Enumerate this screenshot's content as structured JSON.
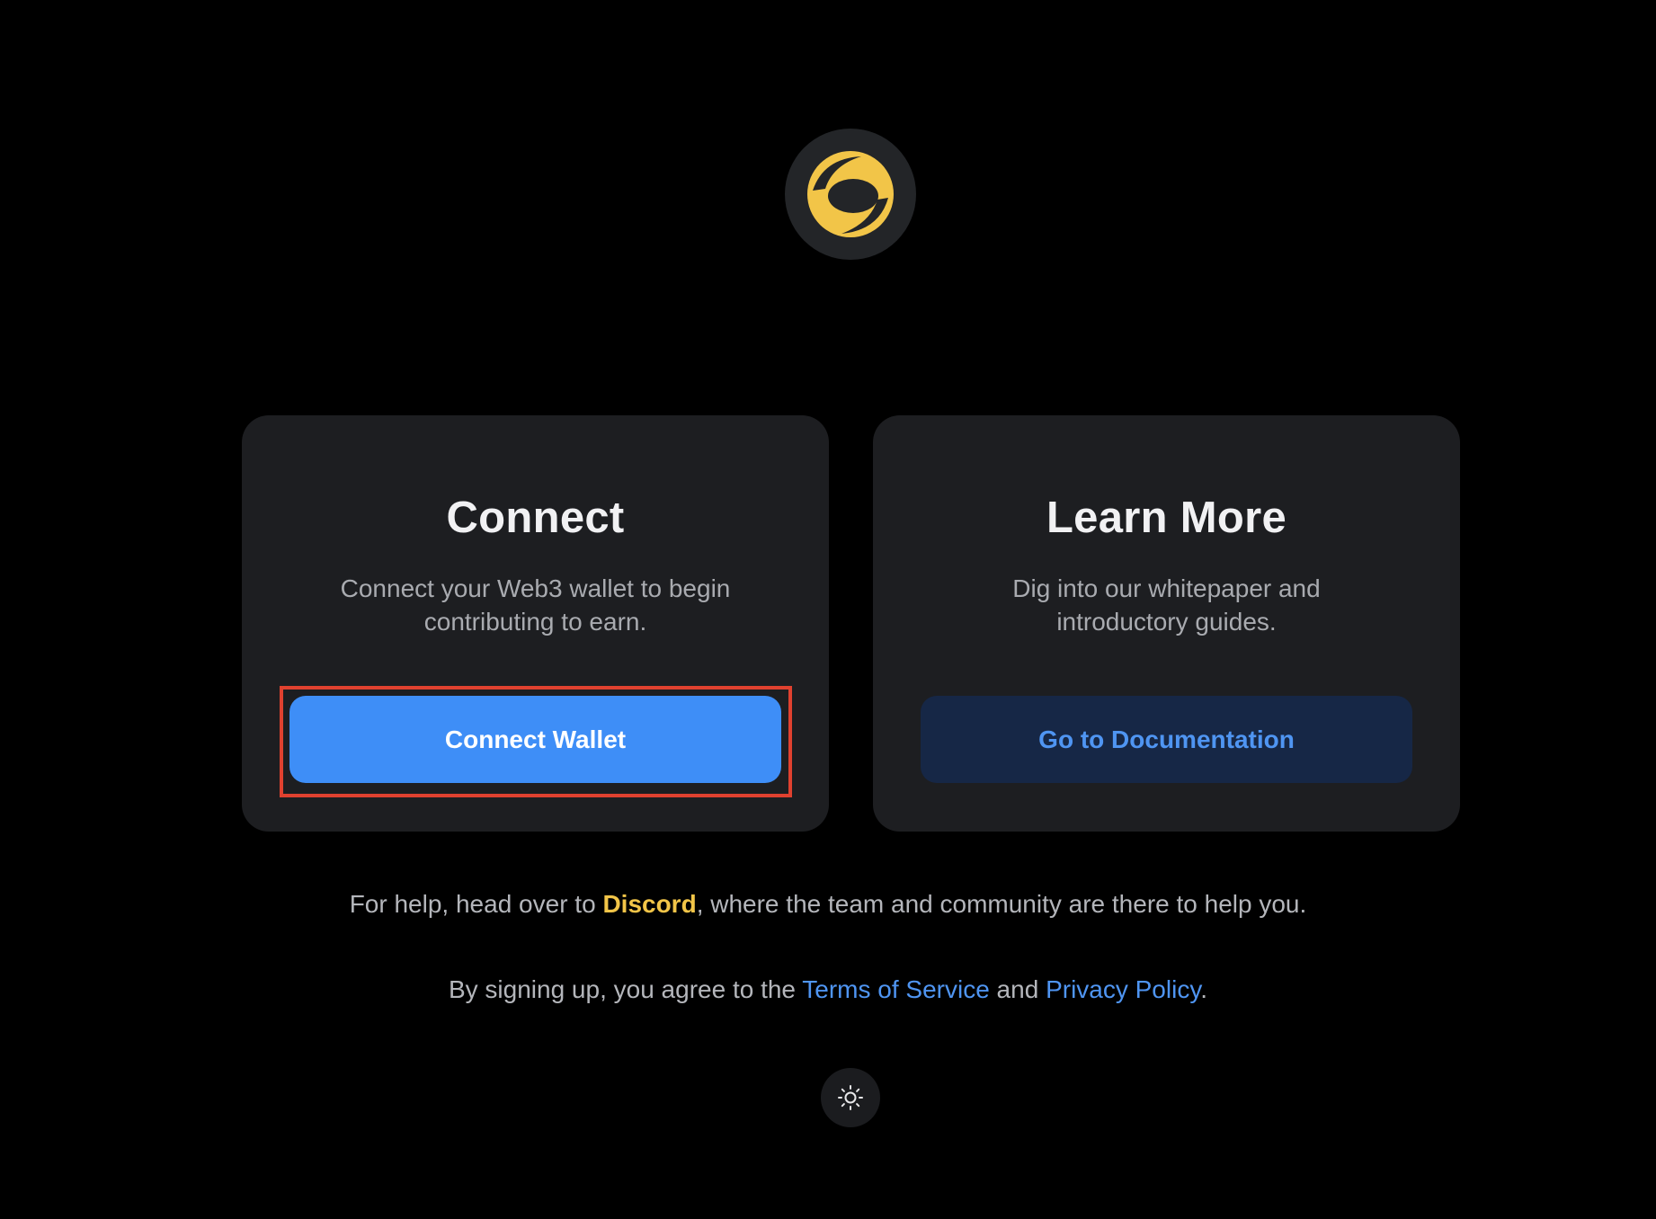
{
  "colors": {
    "background": "#000000",
    "card": "#1d1e21",
    "primary_button": "#3e8ef7",
    "secondary_button": "#162746",
    "link_blue": "#4f95f2",
    "discord_gold": "#f2c548",
    "logo_gold": "#f2c548",
    "highlight_red": "#e0412f"
  },
  "logo": {
    "icon": "brand-logo-icon"
  },
  "connect_card": {
    "title": "Connect",
    "description_line1": "Connect your Web3 wallet to begin",
    "description_line2": "contributing to earn.",
    "button_label": "Connect Wallet"
  },
  "learn_card": {
    "title": "Learn More",
    "description_line1": "Dig into our whitepaper and",
    "description_line2": "introductory guides.",
    "button_label": "Go to Documentation"
  },
  "help": {
    "prefix": "For help, head over to ",
    "link": "Discord",
    "suffix": ", where the team and community are there to help you."
  },
  "terms": {
    "prefix": "By signing up, you agree to the ",
    "tos_link": "Terms of Service",
    "middle": " and ",
    "privacy_link": "Privacy Policy",
    "suffix": "."
  },
  "theme_toggle": {
    "icon": "sun-icon"
  }
}
